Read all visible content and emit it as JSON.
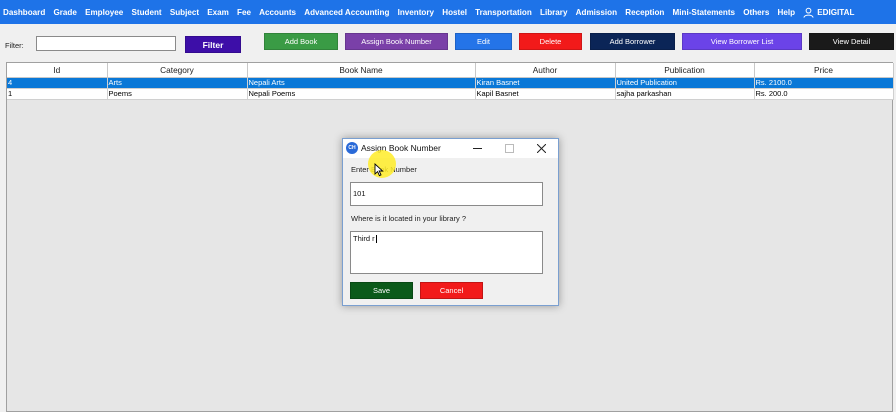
{
  "nav": {
    "items": [
      "Dashboard",
      "Grade",
      "Employee",
      "Student",
      "Subject",
      "Exam",
      "Fee",
      "Accounts",
      "Advanced Accounting",
      "Inventory",
      "Hostel",
      "Transportation",
      "Library",
      "Admission",
      "Reception",
      "Mini-Statements",
      "Others",
      "Help"
    ],
    "user": "EDIGITAL",
    "user_icon": "user-icon",
    "bar_color": "#1e73e8"
  },
  "toolbar": {
    "filter_label": "Filter:",
    "filter_value": "",
    "filter_button": "Filter",
    "add_book": "Add Book",
    "assign_book_number": "Assign Book Number",
    "edit": "Edit",
    "delete": "Delete",
    "add_borrower": "Add Borrower",
    "view_borrower_list": "View Borrower List",
    "view_detail": "View Detail"
  },
  "table": {
    "columns": [
      "Id",
      "Category",
      "Book Name",
      "Author",
      "Publication",
      "Price"
    ],
    "rows": [
      [
        "4",
        "Arts",
        "Nepali Arts",
        "Kiran Basnet",
        "United Publication",
        "Rs. 2100.0"
      ],
      [
        "1",
        "Poems",
        "Nepali Poems",
        "Kapil Basnet",
        "sajha parkashan",
        "Rs. 200.0"
      ]
    ],
    "selected_row": 0,
    "selected_color": "#0a78d7"
  },
  "dialog": {
    "title": "Assign Book Number",
    "app_icon_text": "CH",
    "book_number_label": "Enter Book Number",
    "book_number_value": "101",
    "location_label": "Where is it located in your library ?",
    "location_value": "Third r",
    "save": "Save",
    "cancel": "Cancel"
  }
}
